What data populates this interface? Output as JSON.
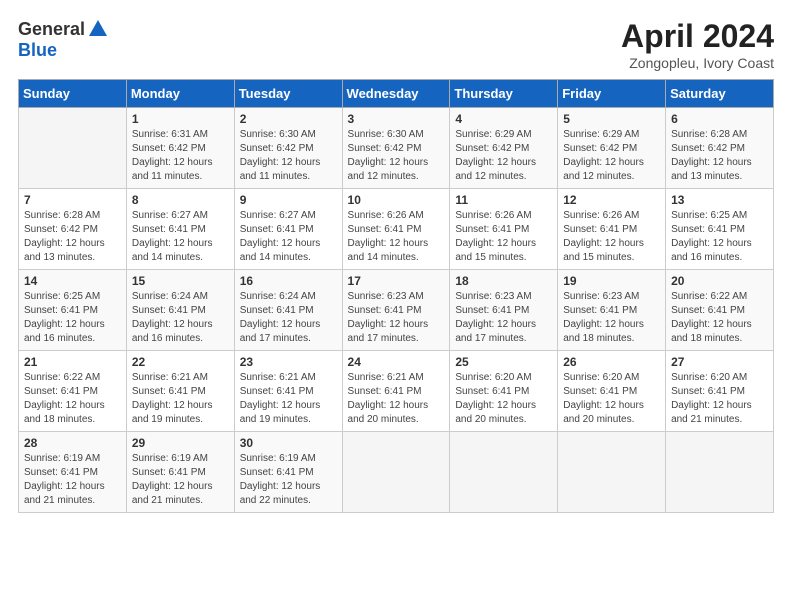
{
  "header": {
    "logo_general": "General",
    "logo_blue": "Blue",
    "title": "April 2024",
    "subtitle": "Zongopleu, Ivory Coast"
  },
  "days_of_week": [
    "Sunday",
    "Monday",
    "Tuesday",
    "Wednesday",
    "Thursday",
    "Friday",
    "Saturday"
  ],
  "weeks": [
    [
      {
        "day": "",
        "sunrise": "",
        "sunset": "",
        "daylight": ""
      },
      {
        "day": "1",
        "sunrise": "Sunrise: 6:31 AM",
        "sunset": "Sunset: 6:42 PM",
        "daylight": "Daylight: 12 hours and 11 minutes."
      },
      {
        "day": "2",
        "sunrise": "Sunrise: 6:30 AM",
        "sunset": "Sunset: 6:42 PM",
        "daylight": "Daylight: 12 hours and 11 minutes."
      },
      {
        "day": "3",
        "sunrise": "Sunrise: 6:30 AM",
        "sunset": "Sunset: 6:42 PM",
        "daylight": "Daylight: 12 hours and 12 minutes."
      },
      {
        "day": "4",
        "sunrise": "Sunrise: 6:29 AM",
        "sunset": "Sunset: 6:42 PM",
        "daylight": "Daylight: 12 hours and 12 minutes."
      },
      {
        "day": "5",
        "sunrise": "Sunrise: 6:29 AM",
        "sunset": "Sunset: 6:42 PM",
        "daylight": "Daylight: 12 hours and 12 minutes."
      },
      {
        "day": "6",
        "sunrise": "Sunrise: 6:28 AM",
        "sunset": "Sunset: 6:42 PM",
        "daylight": "Daylight: 12 hours and 13 minutes."
      }
    ],
    [
      {
        "day": "7",
        "sunrise": "Sunrise: 6:28 AM",
        "sunset": "Sunset: 6:42 PM",
        "daylight": "Daylight: 12 hours and 13 minutes."
      },
      {
        "day": "8",
        "sunrise": "Sunrise: 6:27 AM",
        "sunset": "Sunset: 6:41 PM",
        "daylight": "Daylight: 12 hours and 14 minutes."
      },
      {
        "day": "9",
        "sunrise": "Sunrise: 6:27 AM",
        "sunset": "Sunset: 6:41 PM",
        "daylight": "Daylight: 12 hours and 14 minutes."
      },
      {
        "day": "10",
        "sunrise": "Sunrise: 6:26 AM",
        "sunset": "Sunset: 6:41 PM",
        "daylight": "Daylight: 12 hours and 14 minutes."
      },
      {
        "day": "11",
        "sunrise": "Sunrise: 6:26 AM",
        "sunset": "Sunset: 6:41 PM",
        "daylight": "Daylight: 12 hours and 15 minutes."
      },
      {
        "day": "12",
        "sunrise": "Sunrise: 6:26 AM",
        "sunset": "Sunset: 6:41 PM",
        "daylight": "Daylight: 12 hours and 15 minutes."
      },
      {
        "day": "13",
        "sunrise": "Sunrise: 6:25 AM",
        "sunset": "Sunset: 6:41 PM",
        "daylight": "Daylight: 12 hours and 16 minutes."
      }
    ],
    [
      {
        "day": "14",
        "sunrise": "Sunrise: 6:25 AM",
        "sunset": "Sunset: 6:41 PM",
        "daylight": "Daylight: 12 hours and 16 minutes."
      },
      {
        "day": "15",
        "sunrise": "Sunrise: 6:24 AM",
        "sunset": "Sunset: 6:41 PM",
        "daylight": "Daylight: 12 hours and 16 minutes."
      },
      {
        "day": "16",
        "sunrise": "Sunrise: 6:24 AM",
        "sunset": "Sunset: 6:41 PM",
        "daylight": "Daylight: 12 hours and 17 minutes."
      },
      {
        "day": "17",
        "sunrise": "Sunrise: 6:23 AM",
        "sunset": "Sunset: 6:41 PM",
        "daylight": "Daylight: 12 hours and 17 minutes."
      },
      {
        "day": "18",
        "sunrise": "Sunrise: 6:23 AM",
        "sunset": "Sunset: 6:41 PM",
        "daylight": "Daylight: 12 hours and 17 minutes."
      },
      {
        "day": "19",
        "sunrise": "Sunrise: 6:23 AM",
        "sunset": "Sunset: 6:41 PM",
        "daylight": "Daylight: 12 hours and 18 minutes."
      },
      {
        "day": "20",
        "sunrise": "Sunrise: 6:22 AM",
        "sunset": "Sunset: 6:41 PM",
        "daylight": "Daylight: 12 hours and 18 minutes."
      }
    ],
    [
      {
        "day": "21",
        "sunrise": "Sunrise: 6:22 AM",
        "sunset": "Sunset: 6:41 PM",
        "daylight": "Daylight: 12 hours and 18 minutes."
      },
      {
        "day": "22",
        "sunrise": "Sunrise: 6:21 AM",
        "sunset": "Sunset: 6:41 PM",
        "daylight": "Daylight: 12 hours and 19 minutes."
      },
      {
        "day": "23",
        "sunrise": "Sunrise: 6:21 AM",
        "sunset": "Sunset: 6:41 PM",
        "daylight": "Daylight: 12 hours and 19 minutes."
      },
      {
        "day": "24",
        "sunrise": "Sunrise: 6:21 AM",
        "sunset": "Sunset: 6:41 PM",
        "daylight": "Daylight: 12 hours and 20 minutes."
      },
      {
        "day": "25",
        "sunrise": "Sunrise: 6:20 AM",
        "sunset": "Sunset: 6:41 PM",
        "daylight": "Daylight: 12 hours and 20 minutes."
      },
      {
        "day": "26",
        "sunrise": "Sunrise: 6:20 AM",
        "sunset": "Sunset: 6:41 PM",
        "daylight": "Daylight: 12 hours and 20 minutes."
      },
      {
        "day": "27",
        "sunrise": "Sunrise: 6:20 AM",
        "sunset": "Sunset: 6:41 PM",
        "daylight": "Daylight: 12 hours and 21 minutes."
      }
    ],
    [
      {
        "day": "28",
        "sunrise": "Sunrise: 6:19 AM",
        "sunset": "Sunset: 6:41 PM",
        "daylight": "Daylight: 12 hours and 21 minutes."
      },
      {
        "day": "29",
        "sunrise": "Sunrise: 6:19 AM",
        "sunset": "Sunset: 6:41 PM",
        "daylight": "Daylight: 12 hours and 21 minutes."
      },
      {
        "day": "30",
        "sunrise": "Sunrise: 6:19 AM",
        "sunset": "Sunset: 6:41 PM",
        "daylight": "Daylight: 12 hours and 22 minutes."
      },
      {
        "day": "",
        "sunrise": "",
        "sunset": "",
        "daylight": ""
      },
      {
        "day": "",
        "sunrise": "",
        "sunset": "",
        "daylight": ""
      },
      {
        "day": "",
        "sunrise": "",
        "sunset": "",
        "daylight": ""
      },
      {
        "day": "",
        "sunrise": "",
        "sunset": "",
        "daylight": ""
      }
    ]
  ]
}
